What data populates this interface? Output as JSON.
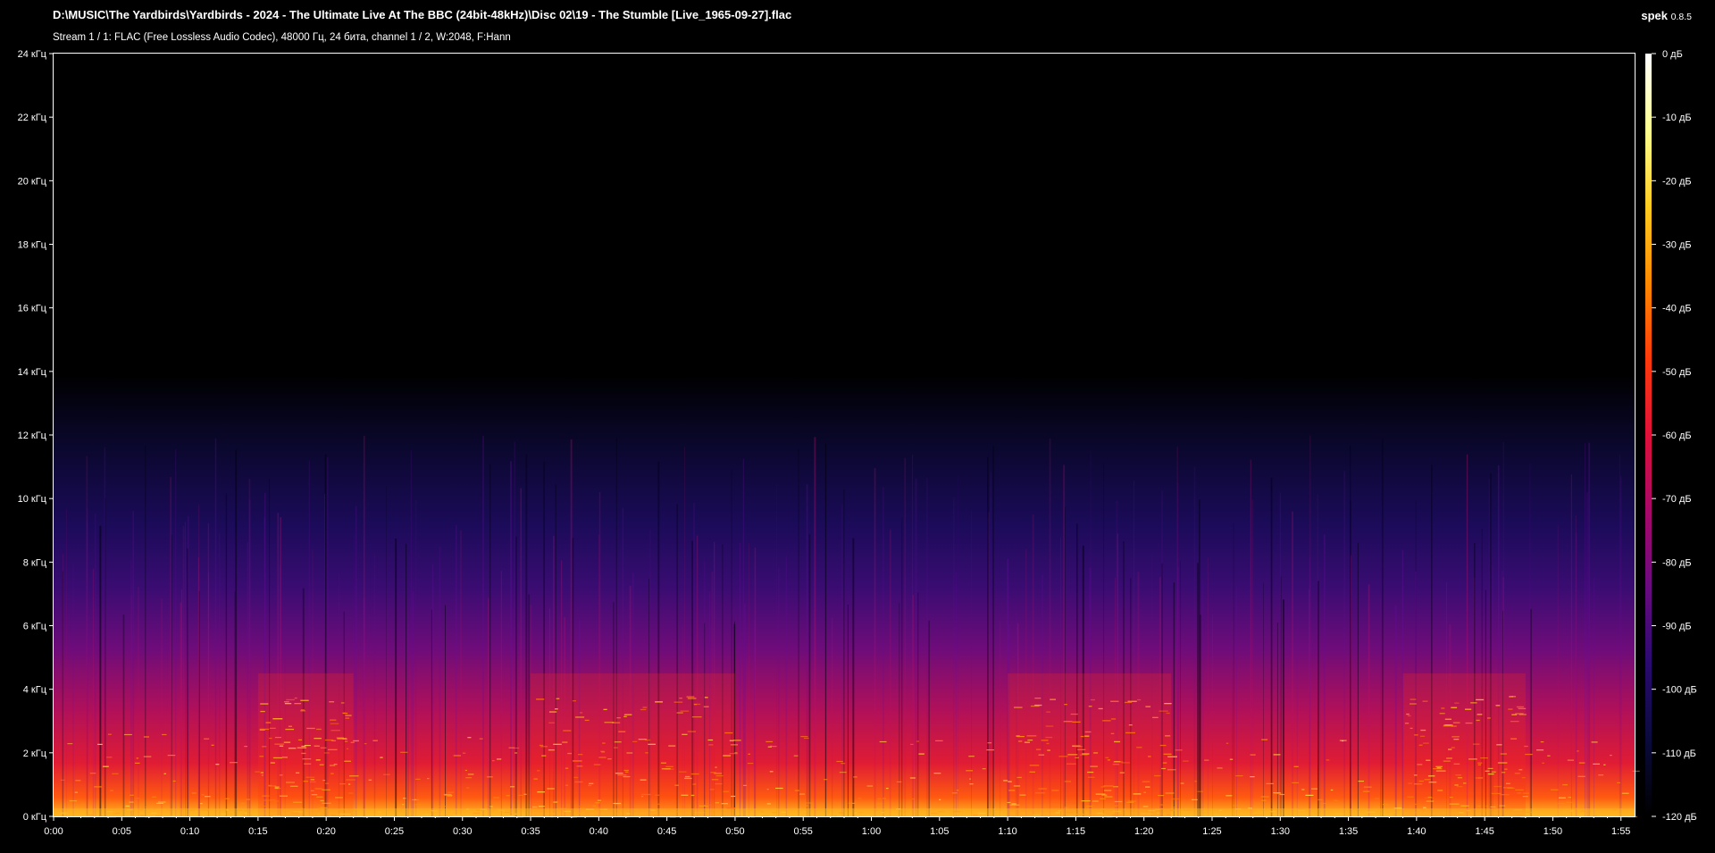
{
  "header": {
    "file_title": "D:\\MUSIC\\The Yardbirds\\Yardbirds - 2024 - The Ultimate Live At The BBC (24bit-48kHz)\\Disc 02\\19 - The Stumble [Live_1965-09-27].flac",
    "stream_info": "Stream 1 / 1: FLAC (Free Lossless Audio Codec), 48000 Гц, 24 бита, channel 1 / 2, W:2048, F:Hann",
    "app_name": "spek",
    "app_version": "0.8.5"
  },
  "chart_data": {
    "type": "heatmap",
    "title": "",
    "x_axis": {
      "unit": "time",
      "range": [
        "0:00",
        "1:56"
      ],
      "tick_labels": [
        "0:00",
        "0:05",
        "0:10",
        "0:15",
        "0:20",
        "0:25",
        "0:30",
        "0:35",
        "0:40",
        "0:45",
        "0:50",
        "0:55",
        "1:00",
        "1:05",
        "1:10",
        "1:15",
        "1:20",
        "1:25",
        "1:30",
        "1:35",
        "1:40",
        "1:45",
        "1:50",
        "1:55"
      ],
      "tick_values_s": [
        0,
        5,
        10,
        15,
        20,
        25,
        30,
        35,
        40,
        45,
        50,
        55,
        60,
        65,
        70,
        75,
        80,
        85,
        90,
        95,
        100,
        105,
        110,
        115
      ],
      "max_s": 116
    },
    "y_axis": {
      "unit": "kHz",
      "range": [
        0,
        24
      ],
      "tick_values": [
        0,
        2,
        4,
        6,
        8,
        10,
        12,
        14,
        16,
        18,
        20,
        22,
        24
      ],
      "tick_labels": [
        "0 кГц",
        "2 кГц",
        "4 кГц",
        "6 кГц",
        "8 кГц",
        "10 кГц",
        "12 кГц",
        "14 кГц",
        "16 кГц",
        "18 кГц",
        "20 кГц",
        "22 кГц",
        "24 кГц"
      ]
    },
    "color_scale": {
      "unit": "dB",
      "range": [
        -120,
        0
      ],
      "tick_values": [
        0,
        -10,
        -20,
        -30,
        -40,
        -50,
        -60,
        -70,
        -80,
        -90,
        -100,
        -110,
        -120
      ],
      "tick_labels": [
        "0 дБ",
        "-10 дБ",
        "-20 дБ",
        "-30 дБ",
        "-40 дБ",
        "-50 дБ",
        "-60 дБ",
        "-70 дБ",
        "-80 дБ",
        "-90 дБ",
        "-100 дБ",
        "-110 дБ",
        "-120 дБ"
      ],
      "colors": [
        "#000000",
        "#0a0a3c",
        "#2a0a70",
        "#6a0a80",
        "#a8086a",
        "#e0103a",
        "#ff3a0a",
        "#ff8a00",
        "#ffcc20",
        "#ffff90",
        "#ffffff"
      ]
    },
    "observed": {
      "content_cutoff_khz": 12,
      "dense_energy_below_khz": 7,
      "loud_sections_s": [
        [
          15,
          22
        ],
        [
          35,
          50
        ],
        [
          70,
          82
        ],
        [
          99,
          108
        ]
      ]
    },
    "grid": false,
    "legend_position": "right"
  }
}
